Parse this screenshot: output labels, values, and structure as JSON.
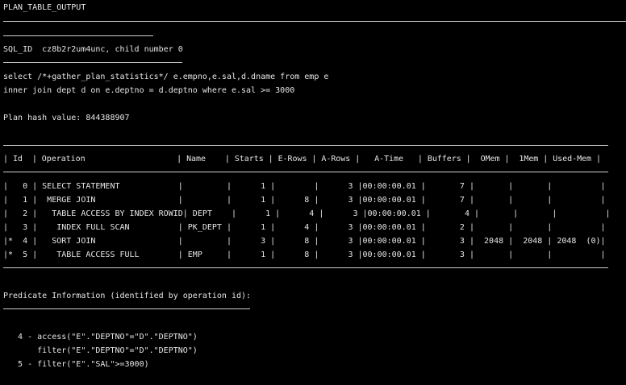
{
  "header": {
    "title": "PLAN_TABLE_OUTPUT"
  },
  "plan": {
    "sql_id_line": "SQL_ID  cz8b2r2um4unc, child number 0",
    "sql_lines": [
      "select /*+gather_plan_statistics*/ e.empno,e.sal,d.dname from emp e",
      "inner join dept d on e.deptno = d.deptno where e.sal >= 3000"
    ],
    "hash_line": "Plan hash value: 844388907",
    "table_header": "| Id  | Operation                   | Name    | Starts | E-Rows | A-Rows |   A-Time   | Buffers |  OMem |  1Mem | Used-Mem |",
    "table_rows": [
      "|   0 | SELECT STATEMENT            |         |      1 |        |      3 |00:00:00.01 |       7 |       |       |          |",
      "|   1 |  MERGE JOIN                 |         |      1 |      8 |      3 |00:00:00.01 |       7 |       |       |          |",
      "|   2 |   TABLE ACCESS BY INDEX ROWID| DEPT    |      1 |      4 |      3 |00:00:00.01 |       4 |       |       |          |",
      "|   3 |    INDEX FULL SCAN          | PK_DEPT |      1 |      4 |      3 |00:00:00.01 |       2 |       |       |          |",
      "|*  4 |   SORT JOIN                 |         |      3 |      8 |      3 |00:00:00.01 |       3 |  2048 |  2048 | 2048  (0)|",
      "|*  5 |    TABLE ACCESS FULL        | EMP     |      1 |      8 |      3 |00:00:00.01 |       3 |       |       |          |"
    ],
    "predicate_title": "Predicate Information (identified by operation id):",
    "predicates": [
      "   4 - access(\"E\".\"DEPTNO\"=\"D\".\"DEPTNO\")",
      "       filter(\"E\".\"DEPTNO\"=\"D\".\"DEPTNO\")",
      "   5 - filter(\"E\".\"SAL\">=3000)"
    ]
  }
}
